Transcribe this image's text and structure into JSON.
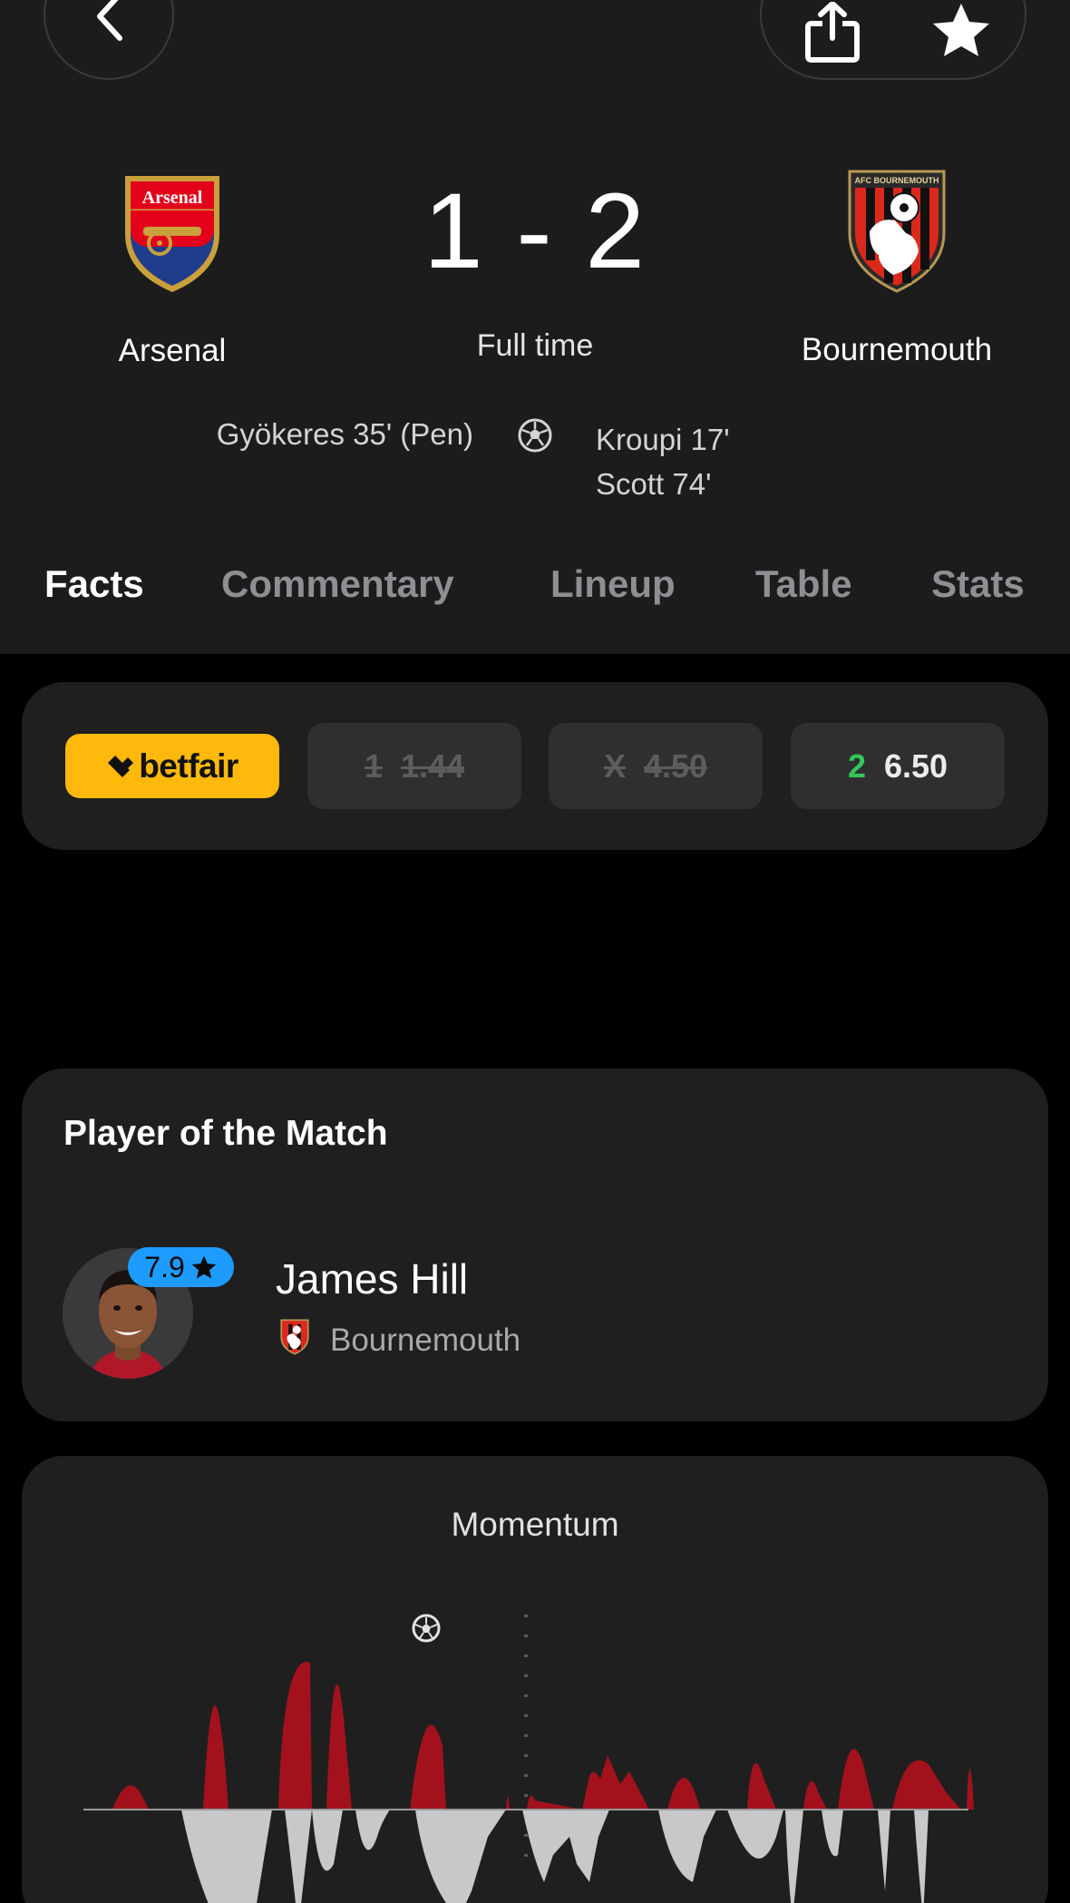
{
  "match": {
    "home_team": "Arsenal",
    "away_team": "Bournemouth",
    "score": "1 - 2",
    "status": "Full time",
    "home_scorers": [
      "Gyökeres 35' (Pen)"
    ],
    "away_scorers": [
      "Kroupi 17'",
      "Scott 74'"
    ],
    "home_crest_text": "Arsenal",
    "away_crest_text": "AFC BOURNEMOUTH"
  },
  "top_bar": {
    "back_icon": "chevron-left-icon",
    "share_icon": "share-icon",
    "favorite_icon": "star-icon"
  },
  "tabs": [
    "Facts",
    "Commentary",
    "Lineup",
    "Table",
    "Stats"
  ],
  "active_tab": "Facts",
  "odds": {
    "provider": "betfair",
    "options": [
      {
        "key": "1",
        "value": "1.44",
        "suspended": true
      },
      {
        "key": "X",
        "value": "4.50",
        "suspended": true
      },
      {
        "key": "2",
        "value": "6.50",
        "suspended": false
      }
    ]
  },
  "player_of_match": {
    "title": "Player of the Match",
    "name": "James Hill",
    "team": "Bournemouth",
    "rating": "7.9"
  },
  "momentum": {
    "title": "Momentum"
  },
  "colors": {
    "header_bg": "#1c1c1d",
    "card_bg": "#1f1f20",
    "betfair_yellow": "#ffb80c",
    "rating_blue": "#1e9bff",
    "away_momentum": "#a3111c",
    "home_momentum": "#c8c8c8",
    "odds_winner": "#34c759"
  }
}
